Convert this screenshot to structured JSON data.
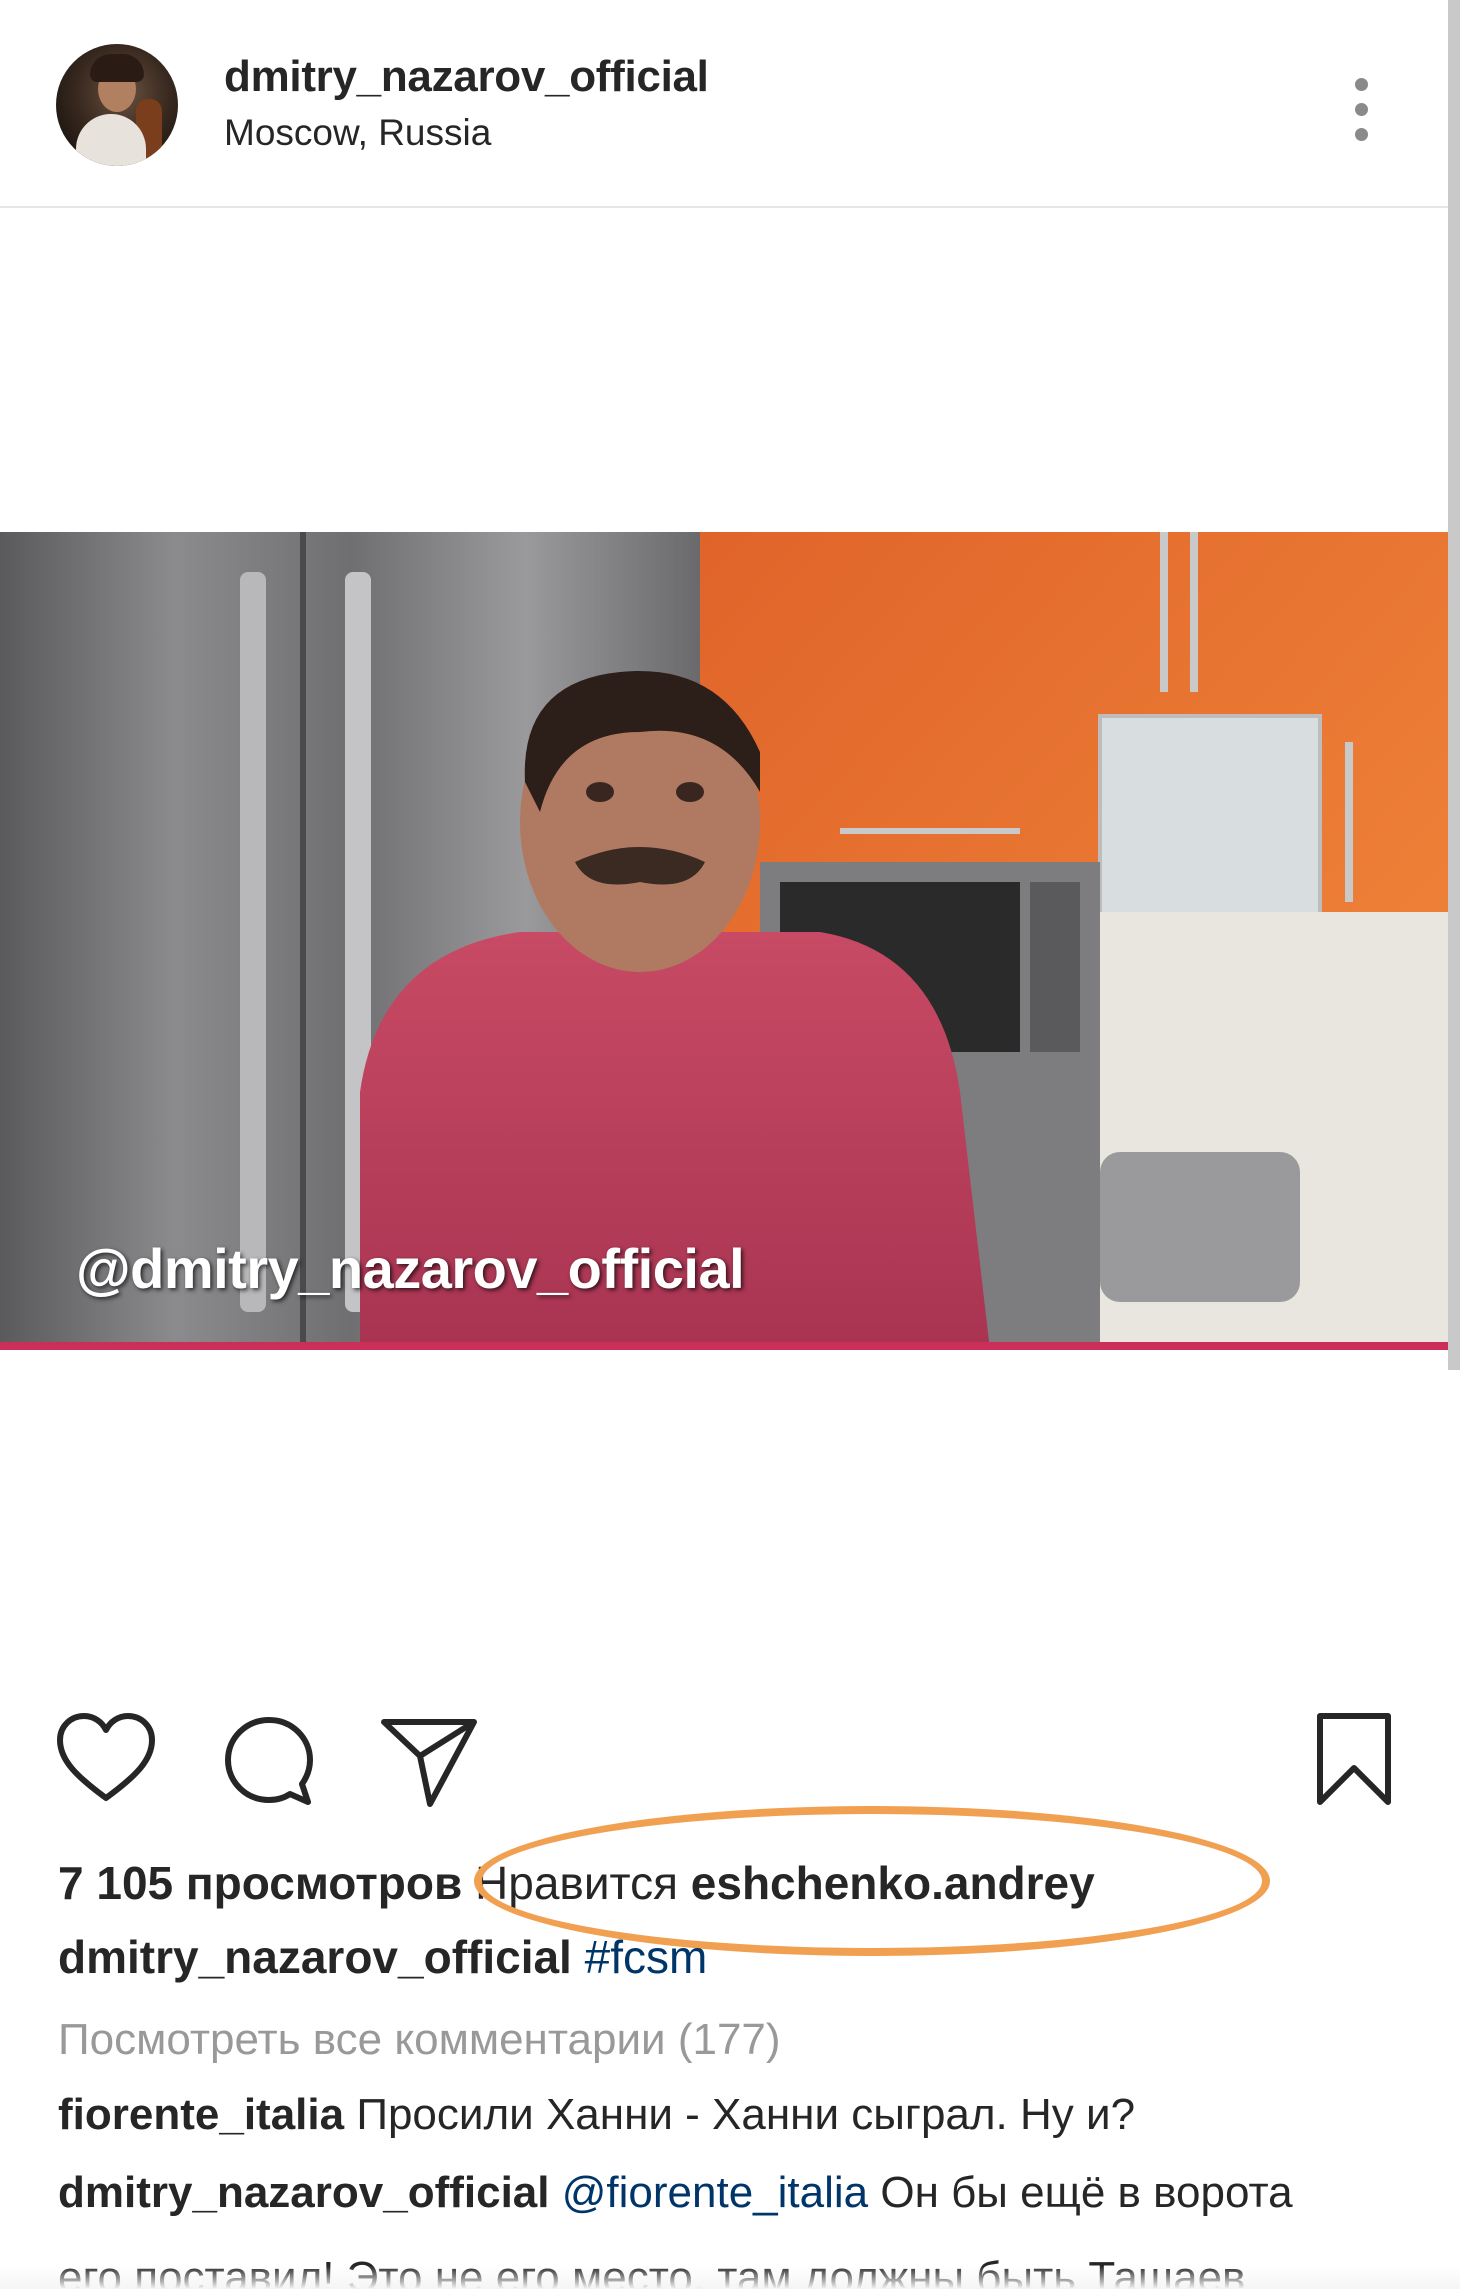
{
  "post": {
    "username": "dmitry_nazarov_official",
    "location": "Moscow, Russia",
    "video_watermark": "@dmitry_nazarov_official"
  },
  "stats": {
    "views": "7 105 просмотров",
    "liked_by_prefix": "Нравится",
    "liked_by_user": "eshchenko.andrey"
  },
  "caption": {
    "author": "dmitry_nazarov_official",
    "hashtag": "#fcsm"
  },
  "comments": {
    "view_all": "Посмотреть все комментарии (177)",
    "items": [
      {
        "author": "fiorente_italia",
        "text": "Просили Ханни - Ханни сыграл. Ну и?"
      },
      {
        "author": "dmitry_nazarov_official",
        "mention": "@fiorente_italia",
        "text": "Он бы ещё в ворота",
        "continuation": "его поставил! Это не его место, там должны быть Ташаев"
      }
    ]
  },
  "colors": {
    "annotation_oval": "#f0a050",
    "link": "#003569",
    "muted_text": "#999999"
  },
  "icons": [
    "heart-icon",
    "comment-icon",
    "share-icon",
    "bookmark-icon",
    "more-options-icon"
  ]
}
